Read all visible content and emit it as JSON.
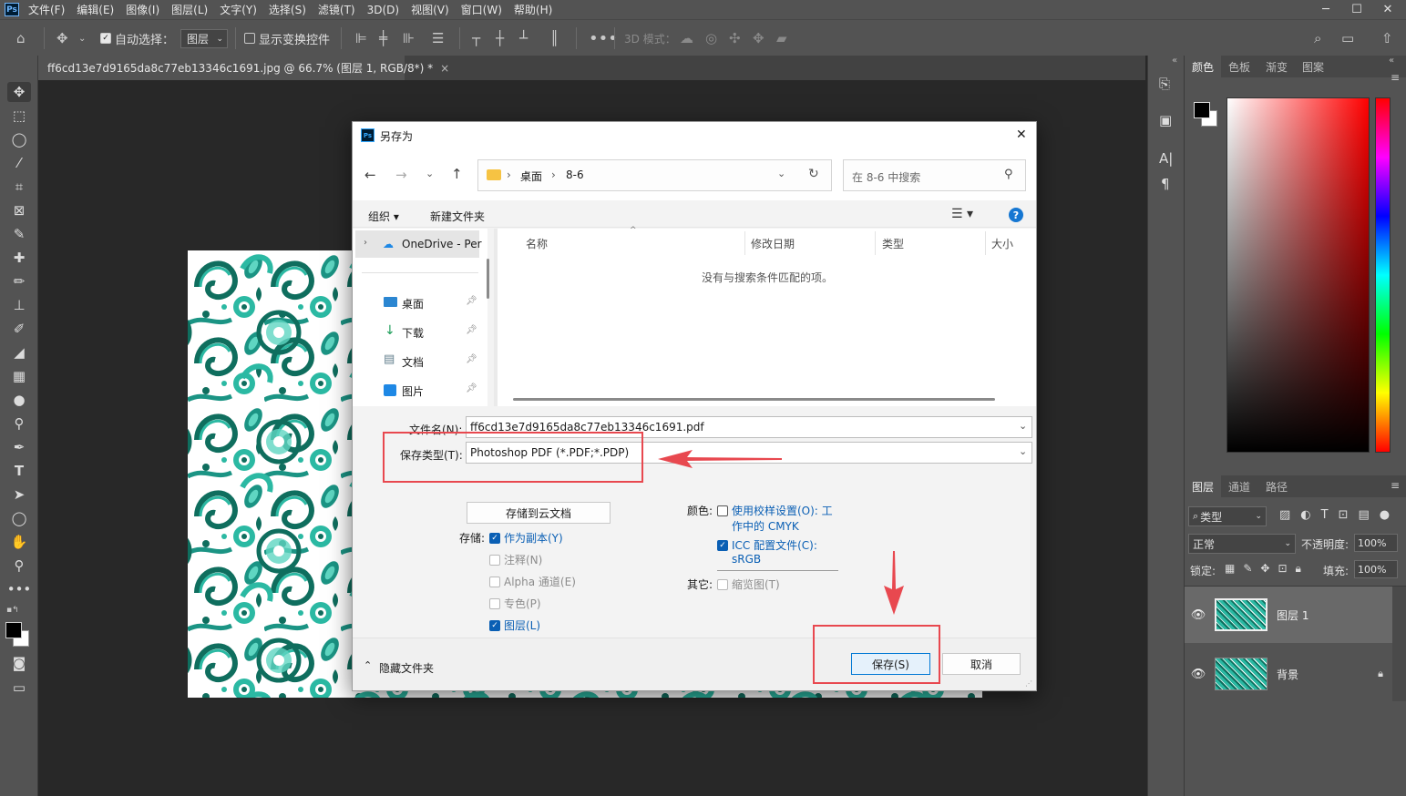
{
  "menubar": {
    "logo": "Ps",
    "items": [
      "文件(F)",
      "编辑(E)",
      "图像(I)",
      "图层(L)",
      "文字(Y)",
      "选择(S)",
      "滤镜(T)",
      "3D(D)",
      "视图(V)",
      "窗口(W)",
      "帮助(H)"
    ],
    "win_min": "─",
    "win_max": "☐",
    "win_close": "✕"
  },
  "options": {
    "auto_select_label": "自动选择：",
    "auto_select_value": "图层",
    "show_transform_label": "显示变换控件",
    "mode_3d_label": "3D 模式："
  },
  "document": {
    "tab_title": "ff6cd13e7d9165da8c77eb13346c1691.jpg @ 66.7% (图层 1, RGB/8*) *",
    "tab_close": "×"
  },
  "color_panel": {
    "tabs": [
      "颜色",
      "色板",
      "渐变",
      "图案"
    ]
  },
  "layers_panel": {
    "tabs": [
      "图层",
      "通道",
      "路径"
    ],
    "filter_label": "类型",
    "blend_mode": "正常",
    "opacity_label": "不透明度:",
    "opacity_value": "100%",
    "lock_label": "锁定:",
    "fill_label": "填充:",
    "fill_value": "100%",
    "layers": [
      {
        "name": "图层 1",
        "selected": true,
        "locked": false
      },
      {
        "name": "背景",
        "selected": false,
        "locked": true
      }
    ]
  },
  "dialog": {
    "title": "另存为",
    "close": "✕",
    "breadcrumb": [
      "桌面",
      "8-6"
    ],
    "search_placeholder": "在 8-6 中搜索",
    "organize_label": "组织",
    "new_folder_label": "新建文件夹",
    "nav_tree": [
      {
        "label": "OneDrive - Per",
        "pinned": false
      },
      {
        "label": "桌面",
        "pinned": true
      },
      {
        "label": "下载",
        "pinned": true
      },
      {
        "label": "文档",
        "pinned": true
      },
      {
        "label": "图片",
        "pinned": true
      }
    ],
    "columns": [
      "名称",
      "修改日期",
      "类型",
      "大小"
    ],
    "empty_message": "没有与搜索条件匹配的项。",
    "filename_label": "文件名(N):",
    "filename_value": "ff6cd13e7d9165da8c77eb13346c1691.pdf",
    "savetype_label": "保存类型(T):",
    "savetype_value": "Photoshop PDF (*.PDF;*.PDP)",
    "cloud_button": "存储到云文档",
    "save_options_label": "存储:",
    "save_options": [
      {
        "label": "作为副本(Y)",
        "checked": true,
        "enabled": true
      },
      {
        "label": "注释(N)",
        "checked": false,
        "enabled": false
      },
      {
        "label": "Alpha 通道(E)",
        "checked": false,
        "enabled": false
      },
      {
        "label": "专色(P)",
        "checked": false,
        "enabled": false
      },
      {
        "label": "图层(L)",
        "checked": true,
        "enabled": true
      }
    ],
    "color_label": "颜色:",
    "proof_setup_line1": "使用校样设置(O): 工",
    "proof_setup_line2": "作中的 CMYK",
    "icc_line1": "ICC 配置文件(C):",
    "icc_line2": "sRGB",
    "other_label": "其它:",
    "thumbnail_label": "缩览图(T)",
    "hide_folders": "隐藏文件夹",
    "save_button": "保存(S)",
    "cancel_button": "取消"
  },
  "colors": {
    "annotation_red": "#e8484f",
    "accent_blue": "#0a5fb4",
    "teal_pattern": "#2bb9a3",
    "dark_teal": "#0f6e5e"
  }
}
